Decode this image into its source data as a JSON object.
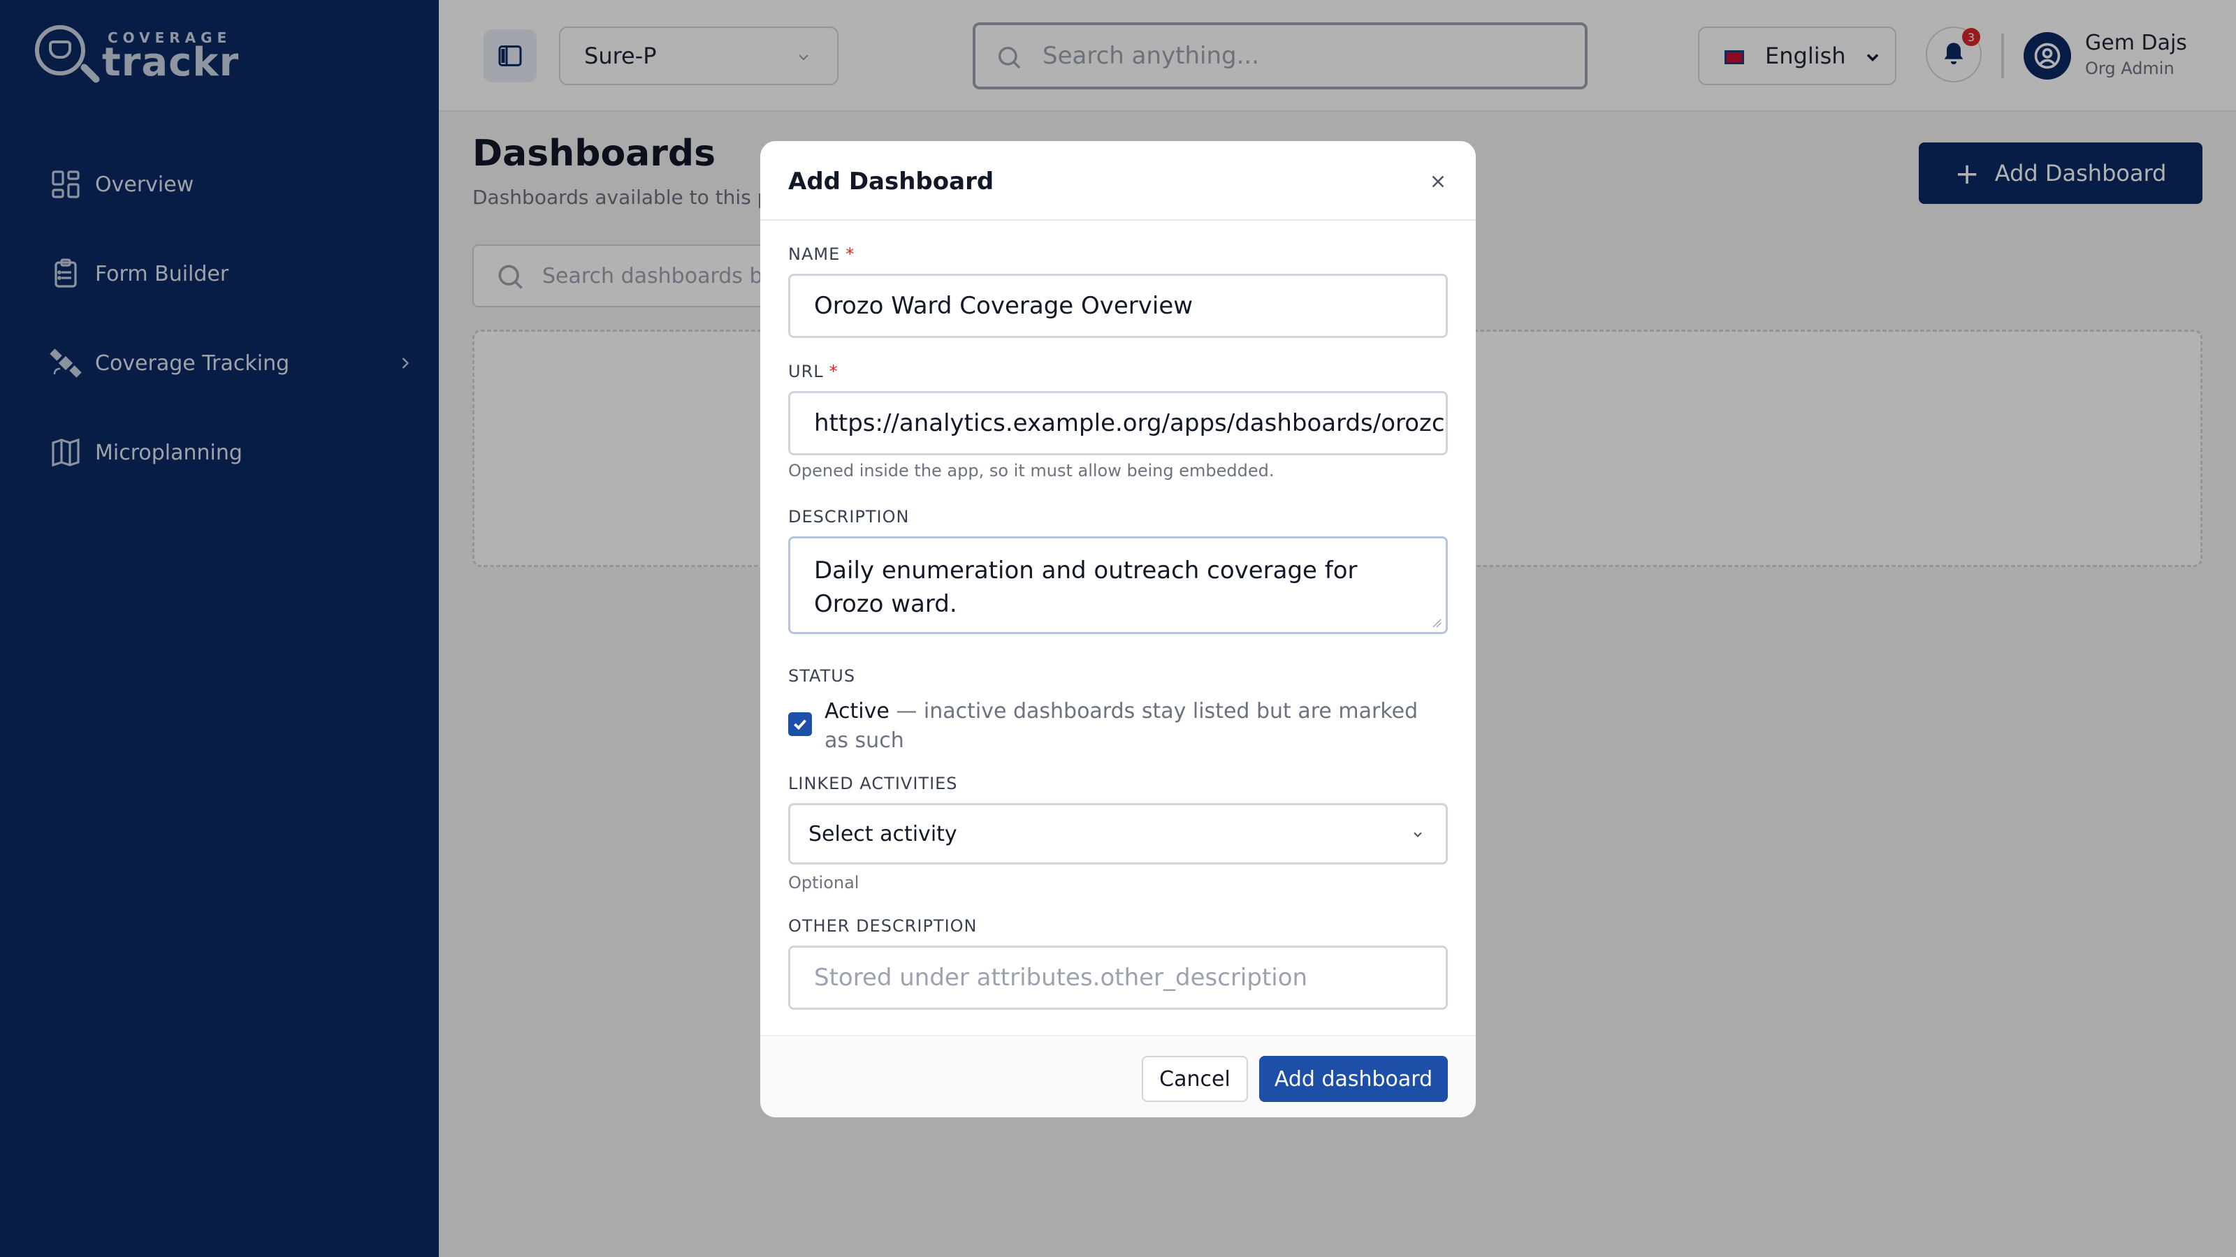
{
  "brand": {
    "small": "COVERAGE",
    "big": "trackr"
  },
  "sidebar": {
    "items": [
      {
        "label": "Overview",
        "icon": "dashboard-grid-icon"
      },
      {
        "label": "Form Builder",
        "icon": "clipboard-list-icon"
      },
      {
        "label": "Coverage Tracking",
        "icon": "satellite-icon",
        "has_submenu": true
      },
      {
        "label": "Microplanning",
        "icon": "map-icon"
      }
    ]
  },
  "topbar": {
    "org_selected": "Sure-P",
    "search_placeholder": "Search anything...",
    "language": "English",
    "notification_count": "3",
    "user_name": "Gem Dajs",
    "user_role": "Org Admin"
  },
  "main": {
    "title": "Dashboards",
    "subtitle": "Dashboards available to this p",
    "add_button": "Add Dashboard",
    "search_placeholder": "Search dashboards by"
  },
  "modal": {
    "title": "Add Dashboard",
    "name_label": "NAME",
    "name_value": "Orozo Ward Coverage Overview",
    "url_label": "URL",
    "url_value": "https://analytics.example.org/apps/dashboards/orozc",
    "url_hint": "Opened inside the app, so it must allow being embedded.",
    "description_label": "DESCRIPTION",
    "description_value": "Daily enumeration and outreach coverage for Orozo ward.",
    "status_label": "STATUS",
    "status_checked": true,
    "status_active": "Active",
    "status_hint": " — inactive dashboards stay listed but are marked as such",
    "linked_label": "LINKED ACTIVITIES",
    "linked_placeholder": "Select activity",
    "linked_hint": "Optional",
    "other_label": "OTHER DESCRIPTION",
    "other_placeholder": "Stored under attributes.other_description",
    "cancel_label": "Cancel",
    "submit_label": "Add dashboard"
  },
  "colors": {
    "sidebar": "#0b2a63",
    "primary": "#1e4fa8",
    "required": "#dc2626"
  }
}
